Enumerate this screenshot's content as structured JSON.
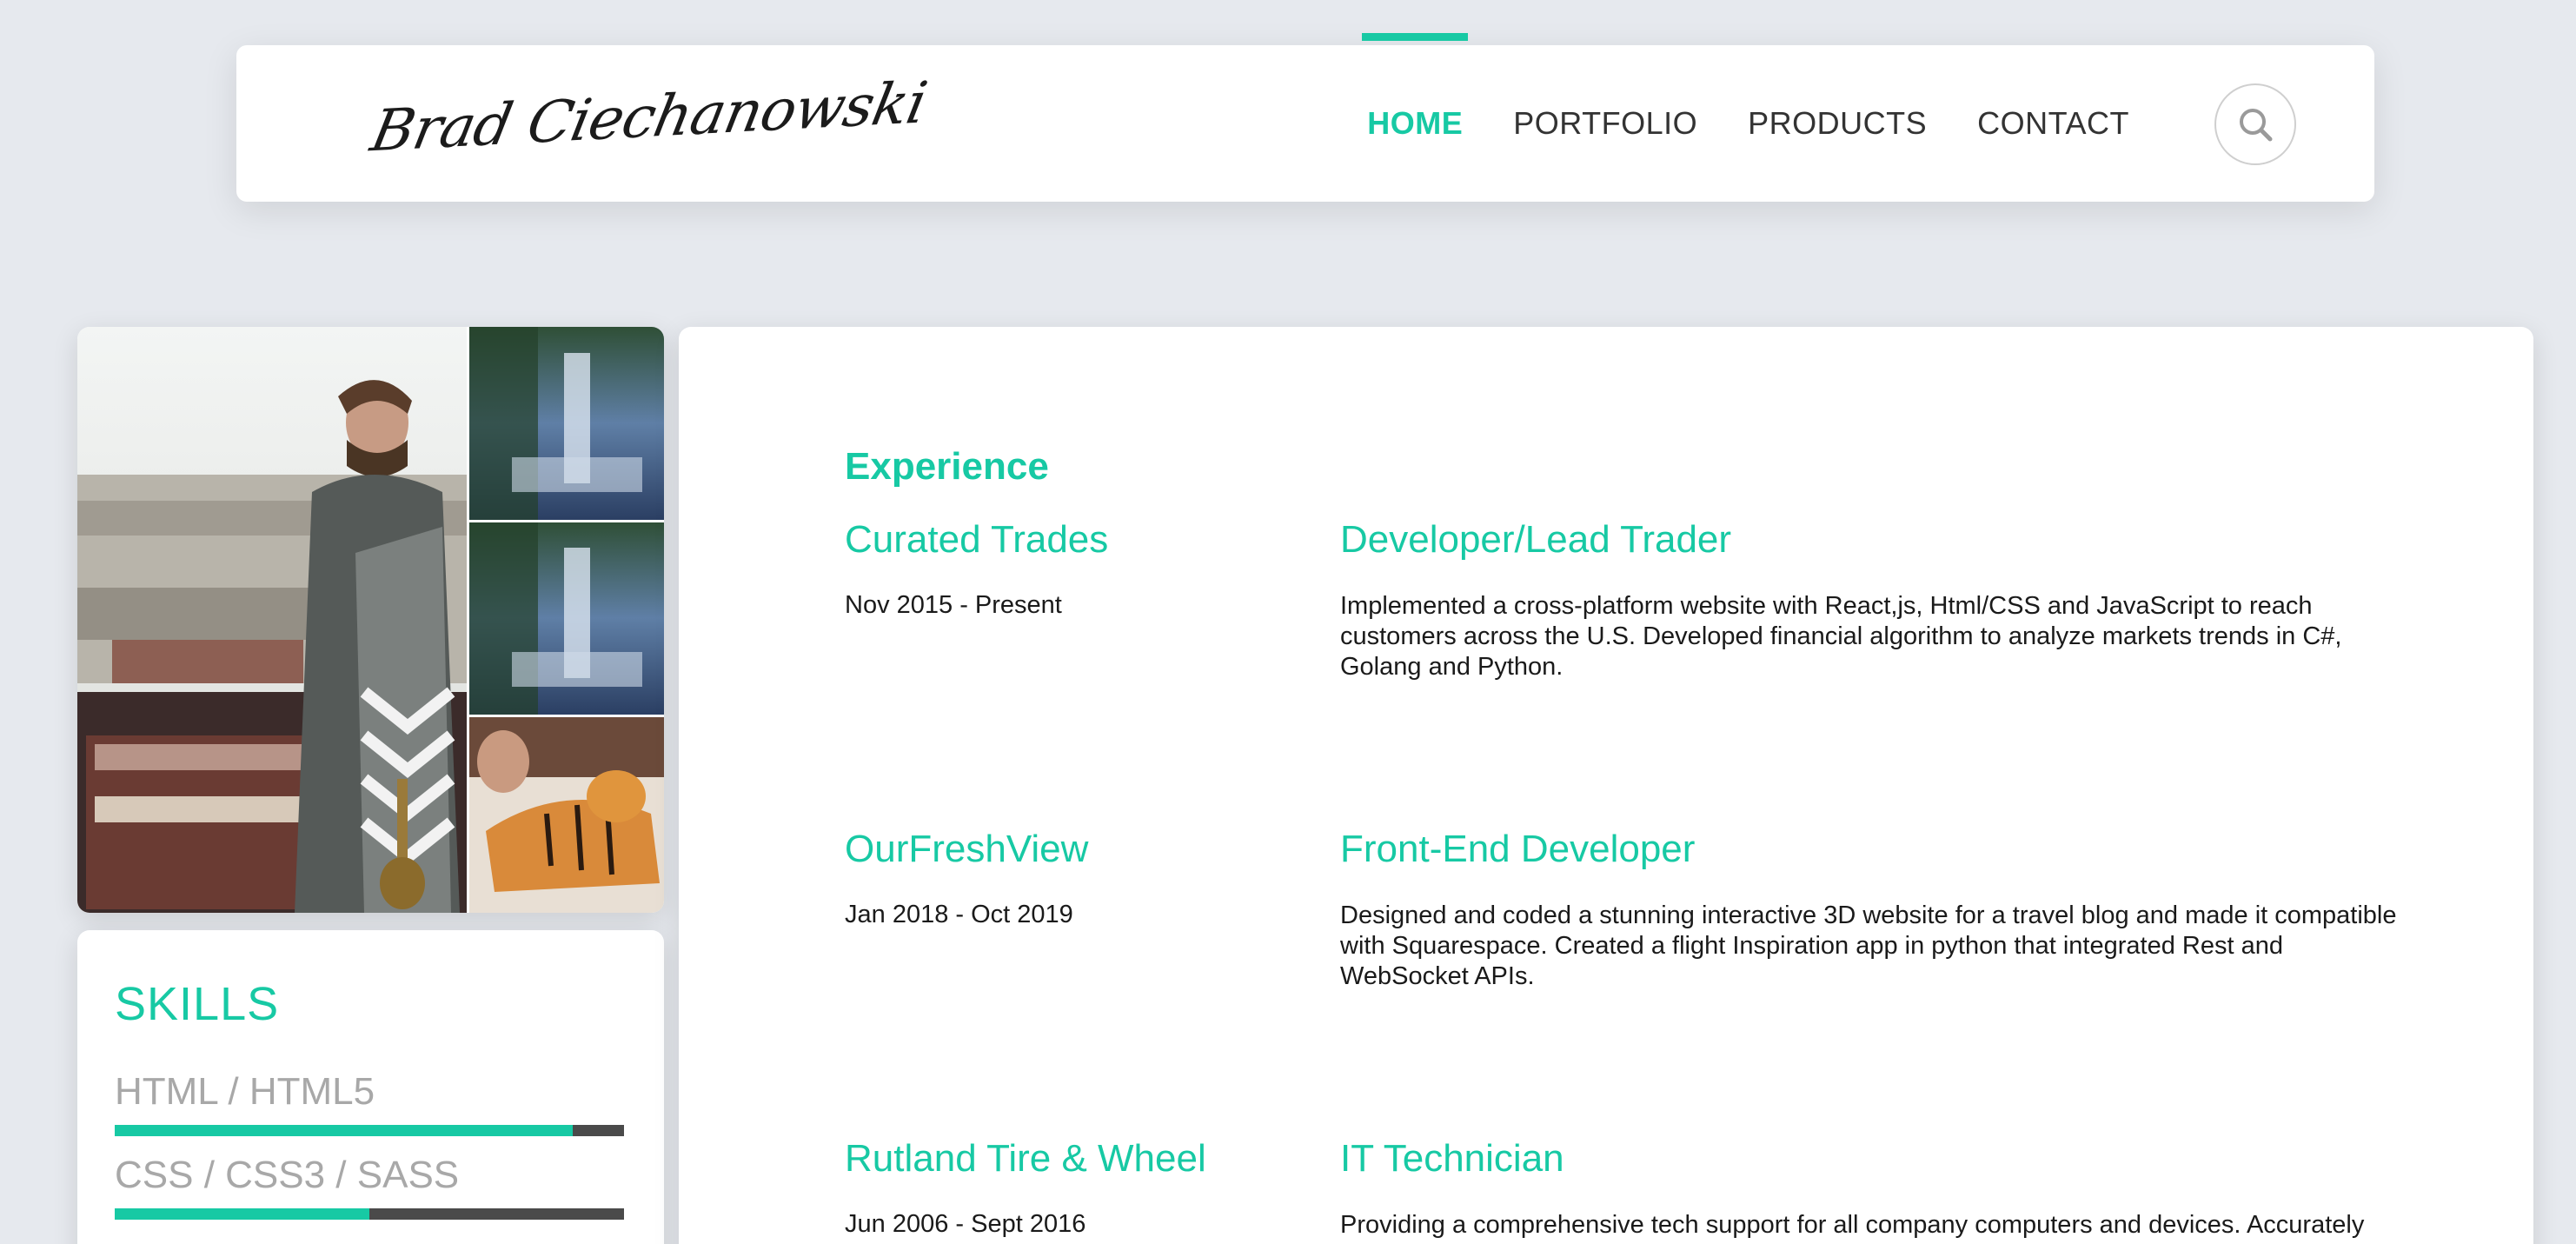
{
  "header": {
    "logo_text": "Brad Ciechanowski",
    "nav": [
      {
        "label": "HOME",
        "active": true
      },
      {
        "label": "PORTFOLIO",
        "active": false
      },
      {
        "label": "PRODUCTS",
        "active": false
      },
      {
        "label": "CONTACT",
        "active": false
      }
    ],
    "search_icon": "search-icon"
  },
  "skills": {
    "title": "SKILLS",
    "items": [
      {
        "label": "HTML / HTML5",
        "level": 0.9
      },
      {
        "label": "CSS / CSS3 / SASS",
        "level": 0.5
      }
    ]
  },
  "experience": {
    "heading": "Experience",
    "entries": [
      {
        "company": "Curated Trades",
        "dates": "Nov 2015 - Present",
        "role": "Developer/Lead Trader",
        "description": "Implemented a cross-platform website with React,js, Html/CSS and JavaScript to reach customers across the U.S. Developed financial algorithm to analyze markets trends in C#, Golang and Python."
      },
      {
        "company": "OurFreshView",
        "dates": "Jan 2018 - Oct 2019",
        "role": "Front-End Developer",
        "description": "Designed and coded a stunning interactive 3D website for a travel blog and made it compatible with Squarespace. Created a flight Inspiration app in python that integrated Rest and WebSocket APIs."
      },
      {
        "company": "Rutland Tire & Wheel",
        "dates": "Jun 2006 - Sept 2016",
        "role": "IT Technician",
        "description": "Providing a comprehensive tech support for all company computers and devices. Accurately"
      }
    ]
  },
  "colors": {
    "accent": "#17c9a4",
    "background": "#e6e9ee",
    "bar_track": "#4a4a4a"
  }
}
